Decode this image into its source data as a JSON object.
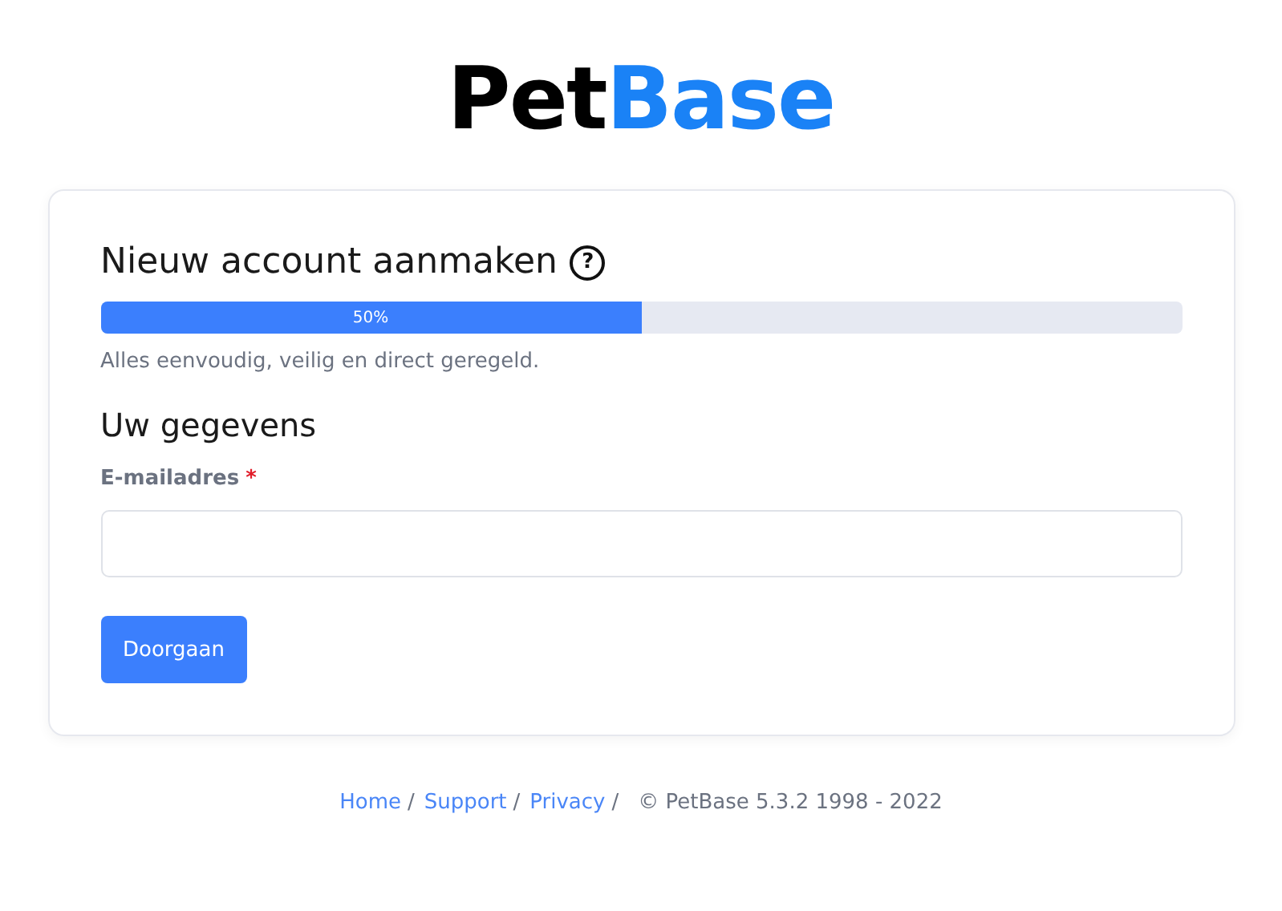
{
  "logo": {
    "first": "Pet",
    "second": "Base"
  },
  "card": {
    "title": "Nieuw account aanmaken",
    "help_icon": "?",
    "progress": {
      "level": 0.5,
      "label": "50%"
    },
    "subtitle": "Alles eenvoudig, veilig en direct geregeld.",
    "section": "Uw gegevens",
    "field": {
      "label": "E-mailadres",
      "required": true,
      "required_mark": "*"
    },
    "button": "Doorgaan"
  },
  "footer": {
    "links": [
      {
        "label": "Home",
        "separator": "/"
      },
      {
        "label": "Support",
        "separator": "/"
      },
      {
        "label": "Privacy",
        "separator": "/"
      }
    ],
    "copyright": "© PetBase 5.3.2 1998 - 2022"
  }
}
